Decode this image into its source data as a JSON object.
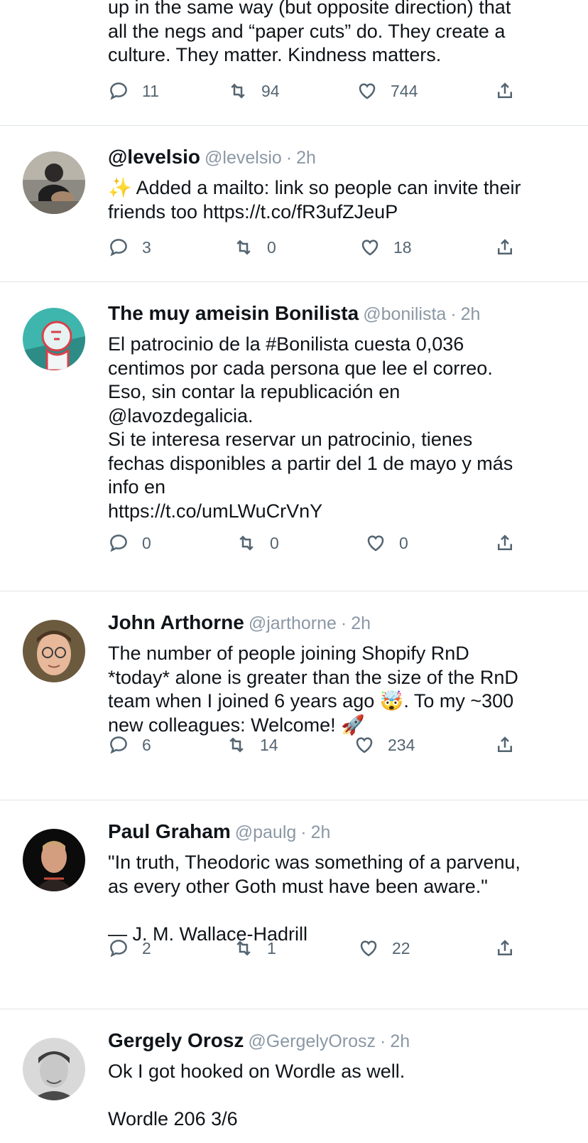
{
  "colors": {
    "text": "#0f1419",
    "secondary": "#536471",
    "meta": "#8b98a5",
    "divider": "#dfe3e7"
  },
  "tweets": [
    {
      "name": "",
      "handle": "",
      "time": "",
      "text": "up in the same way (but opposite direction) that\nall the negs and “paper cuts” do. They create a\nculture. They matter. Kindness matters.",
      "replies": "11",
      "retweets": "94",
      "likes": "744"
    },
    {
      "name": "@levelsio",
      "handle": "@levelsio",
      "time": "2h",
      "text": "✨ Added a mailto: link so people can invite their\nfriends too https://t.co/fR3ufZJeuP",
      "replies": "3",
      "retweets": "0",
      "likes": "18"
    },
    {
      "name": "The muy ameisin Bonilista",
      "handle": "@bonilista",
      "time": "2h",
      "text": "El patrocinio de la #Bonilista cuesta 0,036\ncentimos por cada persona que lee el correo.\nEso, sin contar la republicación en\n@lavozdegalicia.\nSi te interesa reservar un patrocinio, tienes\nfechas disponibles a partir del 1 de mayo y más\ninfo en\nhttps://t.co/umLWuCrVnY",
      "replies": "0",
      "retweets": "0",
      "likes": "0"
    },
    {
      "name": "John Arthorne",
      "handle": "@jarthorne",
      "time": "2h",
      "text": "The number of people joining Shopify RnD\n*today* alone is greater than the size of the RnD\nteam when I joined 6 years ago 🤯. To my ~300\nnew colleagues: Welcome! 🚀",
      "replies": "6",
      "retweets": "14",
      "likes": "234"
    },
    {
      "name": "Paul Graham",
      "handle": "@paulg",
      "time": "2h",
      "text": "\"In truth, Theodoric was something of a parvenu,\nas every other Goth must have been aware.\"\n\n— J. M. Wallace-Hadrill",
      "replies": "2",
      "retweets": "1",
      "likes": "22"
    },
    {
      "name": "Gergely Orosz",
      "handle": "@GergelyOrosz",
      "time": "2h",
      "text": "Ok I got hooked on Wordle as well.\n\nWordle 206 3/6",
      "replies": "",
      "retweets": "",
      "likes": ""
    }
  ]
}
